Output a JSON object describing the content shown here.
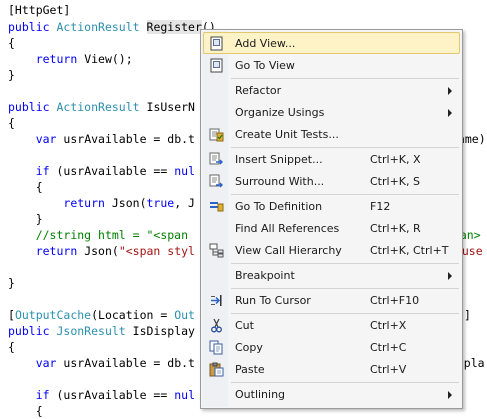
{
  "code": {
    "l1": "[HttpGet]",
    "l2_public": "public",
    "l2_type": "ActionResult",
    "l2_method": "Register",
    "l2_paren": "()",
    "l3": "{",
    "l4_return": "return",
    "l4_rest": "View();",
    "l5": "}",
    "l7_public": "public",
    "l7_type": "ActionResult",
    "l7_method": "IsUserN",
    "l8": "{",
    "l9_var": "var",
    "l9_rest": "usrAvailable = db.t",
    "l9_right": "Name)",
    "l11_if": "if",
    "l11_rest": "(usrAvailable ==",
    "l11_null": "nul",
    "l12": "{",
    "l13_return": "return",
    "l13_rest": "Json(",
    "l13_true": "true",
    "l13_after": ", J",
    "l14": "}",
    "l15_comment": "//string html = \"<span",
    "l15_right": "span>",
    "l16_return": "return",
    "l16_rest": "Json(",
    "l16_str": "\"<span styl",
    "l16_right": "n use",
    "l18": "}",
    "l20_open": "[",
    "l20_attr": "OutputCache",
    "l20_rest": "(Location = ",
    "l20_out": "Out",
    "l20_right": "]",
    "l21_public": "public",
    "l21_type": "JsonResult",
    "l21_method": "IsDisplay",
    "l22": "{",
    "l23_var": "var",
    "l23_rest": "usrAvailable = db.t",
    "l23_right": "Displa",
    "l25_if": "if",
    "l25_rest": "(usrAvailable ==",
    "l25_null": "nul",
    "l26": "{"
  },
  "context_menu": {
    "items": [
      {
        "label": "Add View...",
        "icon": "add-view-icon"
      },
      {
        "label": "Go To View",
        "icon": "go-to-view-icon"
      },
      {
        "label": "Refactor"
      },
      {
        "label": "Organize Usings"
      },
      {
        "label": "Create Unit Tests...",
        "icon": "unit-test-icon"
      },
      {
        "label": "Insert Snippet...",
        "shortcut": "Ctrl+K, X",
        "icon": "insert-snippet-icon"
      },
      {
        "label": "Surround With...",
        "shortcut": "Ctrl+K, S",
        "icon": "surround-with-icon"
      },
      {
        "label": "Go To Definition",
        "shortcut": "F12",
        "icon": "go-to-definition-icon"
      },
      {
        "label": "Find All References",
        "shortcut": "Ctrl+K, R"
      },
      {
        "label": "View Call Hierarchy",
        "shortcut": "Ctrl+K, Ctrl+T",
        "icon": "call-hierarchy-icon"
      },
      {
        "label": "Breakpoint"
      },
      {
        "label": "Run To Cursor",
        "shortcut": "Ctrl+F10",
        "icon": "run-to-cursor-icon"
      },
      {
        "label": "Cut",
        "shortcut": "Ctrl+X",
        "icon": "scissors-icon"
      },
      {
        "label": "Copy",
        "shortcut": "Ctrl+C",
        "icon": "copy-icon"
      },
      {
        "label": "Paste",
        "shortcut": "Ctrl+V",
        "icon": "paste-icon"
      },
      {
        "label": "Outlining"
      }
    ]
  }
}
